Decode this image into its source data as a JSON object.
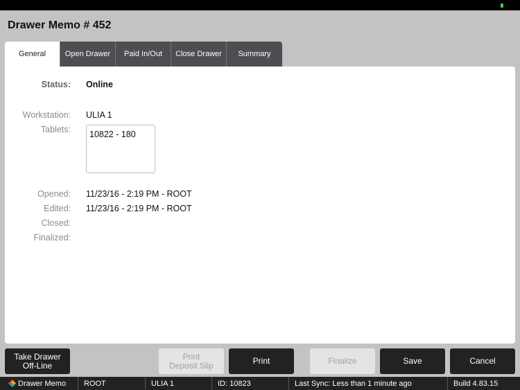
{
  "window": {
    "title": "Drawer Memo # 452"
  },
  "tabs": [
    {
      "label": "General",
      "active": true
    },
    {
      "label": "Open Drawer",
      "active": false
    },
    {
      "label": "Paid In/Out",
      "active": false
    },
    {
      "label": "Close Drawer",
      "active": false
    },
    {
      "label": "Summary",
      "active": false
    }
  ],
  "general": {
    "status_label": "Status:",
    "status_value": "Online",
    "workstation_label": "Workstation:",
    "workstation_value": "ULIA 1",
    "tablets_label": "Tablets:",
    "tablets": [
      "10822 - 180"
    ],
    "opened_label": "Opened:",
    "opened_value": "11/23/16 - 2:19 PM - ROOT",
    "edited_label": "Edited:",
    "edited_value": "11/23/16 - 2:19 PM - ROOT",
    "closed_label": "Closed:",
    "closed_value": "",
    "finalized_label": "Finalized:",
    "finalized_value": ""
  },
  "buttons": {
    "take_offline_line1": "Take Drawer",
    "take_offline_line2": "Off-Line",
    "print_deposit_line1": "Print",
    "print_deposit_line2": "Deposit Slip",
    "print": "Print",
    "finalize": "Finalize",
    "save": "Save",
    "cancel": "Cancel"
  },
  "statusbar": {
    "app": "Drawer Memo",
    "user": "ROOT",
    "workstation": "ULIA 1",
    "id": "ID: 10823",
    "sync": "Last Sync: Less than 1 minute ago",
    "build": "Build 4.83.15"
  },
  "colors": {
    "battery": "#3fd14a",
    "tab_inactive": "#4d4d52",
    "button_dark": "#222222",
    "button_disabled": "#e4e4e4"
  }
}
